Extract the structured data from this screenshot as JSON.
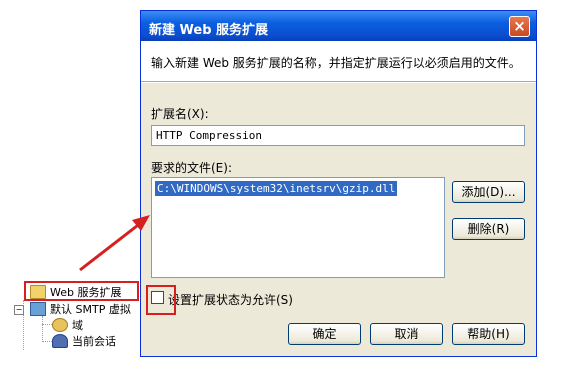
{
  "tree": {
    "items": [
      {
        "label": "Web 服务扩展",
        "icon": "folder-icon"
      },
      {
        "label": "默认 SMTP 虚拟",
        "icon": "smtp-server-icon"
      },
      {
        "label": "域",
        "icon": "domain-icon"
      },
      {
        "label": "当前会话",
        "icon": "session-icon"
      }
    ]
  },
  "dialog": {
    "title": "新建 Web 服务扩展",
    "close_glyph": "×",
    "description": "输入新建 Web 服务扩展的名称，并指定扩展运行以必须启用的文件。",
    "extension_name_label": "扩展名(X):",
    "extension_name_value": "HTTP Compression",
    "required_files_label": "要求的文件(E):",
    "required_files": [
      "C:\\WINDOWS\\system32\\inetsrv\\gzip.dll"
    ],
    "add_button": "添加(D)...",
    "remove_button": "删除(R)",
    "checkbox_label": "设置扩展状态为允许(S)",
    "checkbox_checked": false,
    "ok_button": "确定",
    "cancel_button": "取消",
    "help_button": "帮助(H)"
  }
}
